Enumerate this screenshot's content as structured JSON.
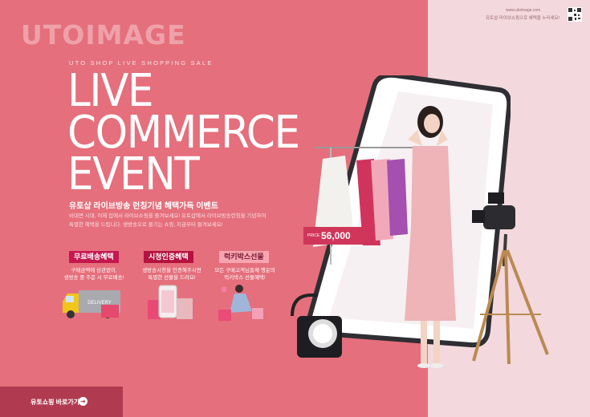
{
  "brand": {
    "logo": "UTOIMAGE"
  },
  "header": {
    "url": "www.utoimage.com",
    "note": "유토샵 라이브쇼핑으로 혜택을 누리세요!"
  },
  "hero": {
    "tagline": "UTO SHOP LIVE SHOPPING SALE",
    "line1": "LIVE",
    "line2": "COMMERCE",
    "line3": "EVENT",
    "subtitle": "유토샵 라이브방송 런칭기념 혜택가득 이벤트",
    "desc1": "비대면 시대, 이제 집에서 라이브쇼핑을 즐겨보세요! 유토샵에서 라이브방송런칭을 기념하여",
    "desc2": "특별한 혜택을 드립니다. 생방송으로 즐기는 쇼핑, 지금부터 즐겨보세요!"
  },
  "benefits": [
    {
      "title": "무료배송혜택",
      "line1": "구매금액에 상관없이,",
      "line2": "생방송 중 주문 시 무료배송!"
    },
    {
      "title": "시청인증혜택",
      "line1": "생방송시청을 인증해주시면",
      "line2": "특별한 선물을 드려요!"
    },
    {
      "title": "럭키박스선물",
      "line1": "모든 구매고객님들께 행운의",
      "line2": "럭키박스 선물혜택!"
    }
  ],
  "truck_label": "DELIVERY",
  "price": {
    "label": "PRICE",
    "value": "56,000"
  },
  "cta": {
    "label": "유토쇼핑 바로가기",
    "arrow": "➔"
  },
  "colors": {
    "left_bg": "#e56f7c",
    "right_bg": "#f3d8dd",
    "accent": "#c4184f",
    "cta_bg": "#b03b50"
  }
}
